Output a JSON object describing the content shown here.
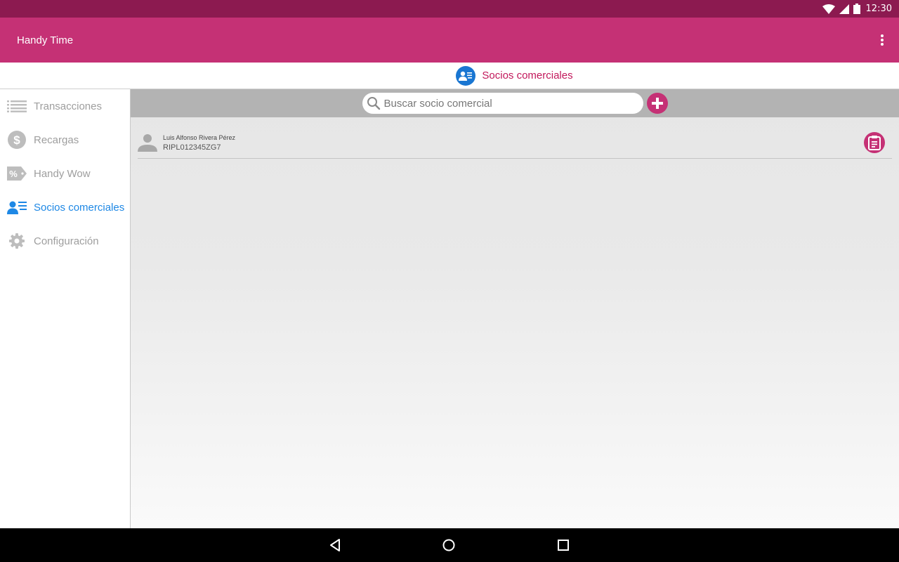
{
  "status_bar": {
    "time": "12:30",
    "icons": [
      "wifi-icon",
      "signal-icon",
      "battery-icon"
    ]
  },
  "app_bar": {
    "title": "Handy Time",
    "menu_icon": "more-vert-icon"
  },
  "section": {
    "title": "Socios comerciales",
    "icon": "business-partners-icon"
  },
  "sidebar": {
    "items": [
      {
        "label": "Transacciones",
        "icon": "list-icon",
        "active": false
      },
      {
        "label": "Recargas",
        "icon": "dollar-icon",
        "active": false
      },
      {
        "label": "Handy Wow",
        "icon": "percent-tag-icon",
        "active": false
      },
      {
        "label": "Socios comerciales",
        "icon": "business-partners-icon",
        "active": true
      },
      {
        "label": "Configuración",
        "icon": "gear-icon",
        "active": false
      }
    ]
  },
  "search": {
    "placeholder": "Buscar socio comercial",
    "value": ""
  },
  "partners": [
    {
      "name": "Luis Alfonso Rivera Pérez",
      "rfc": "RIPL012345ZG7"
    }
  ],
  "colors": {
    "accent": "#c53175",
    "status_bar": "#8c1a50",
    "active_nav": "#1e88e5"
  }
}
